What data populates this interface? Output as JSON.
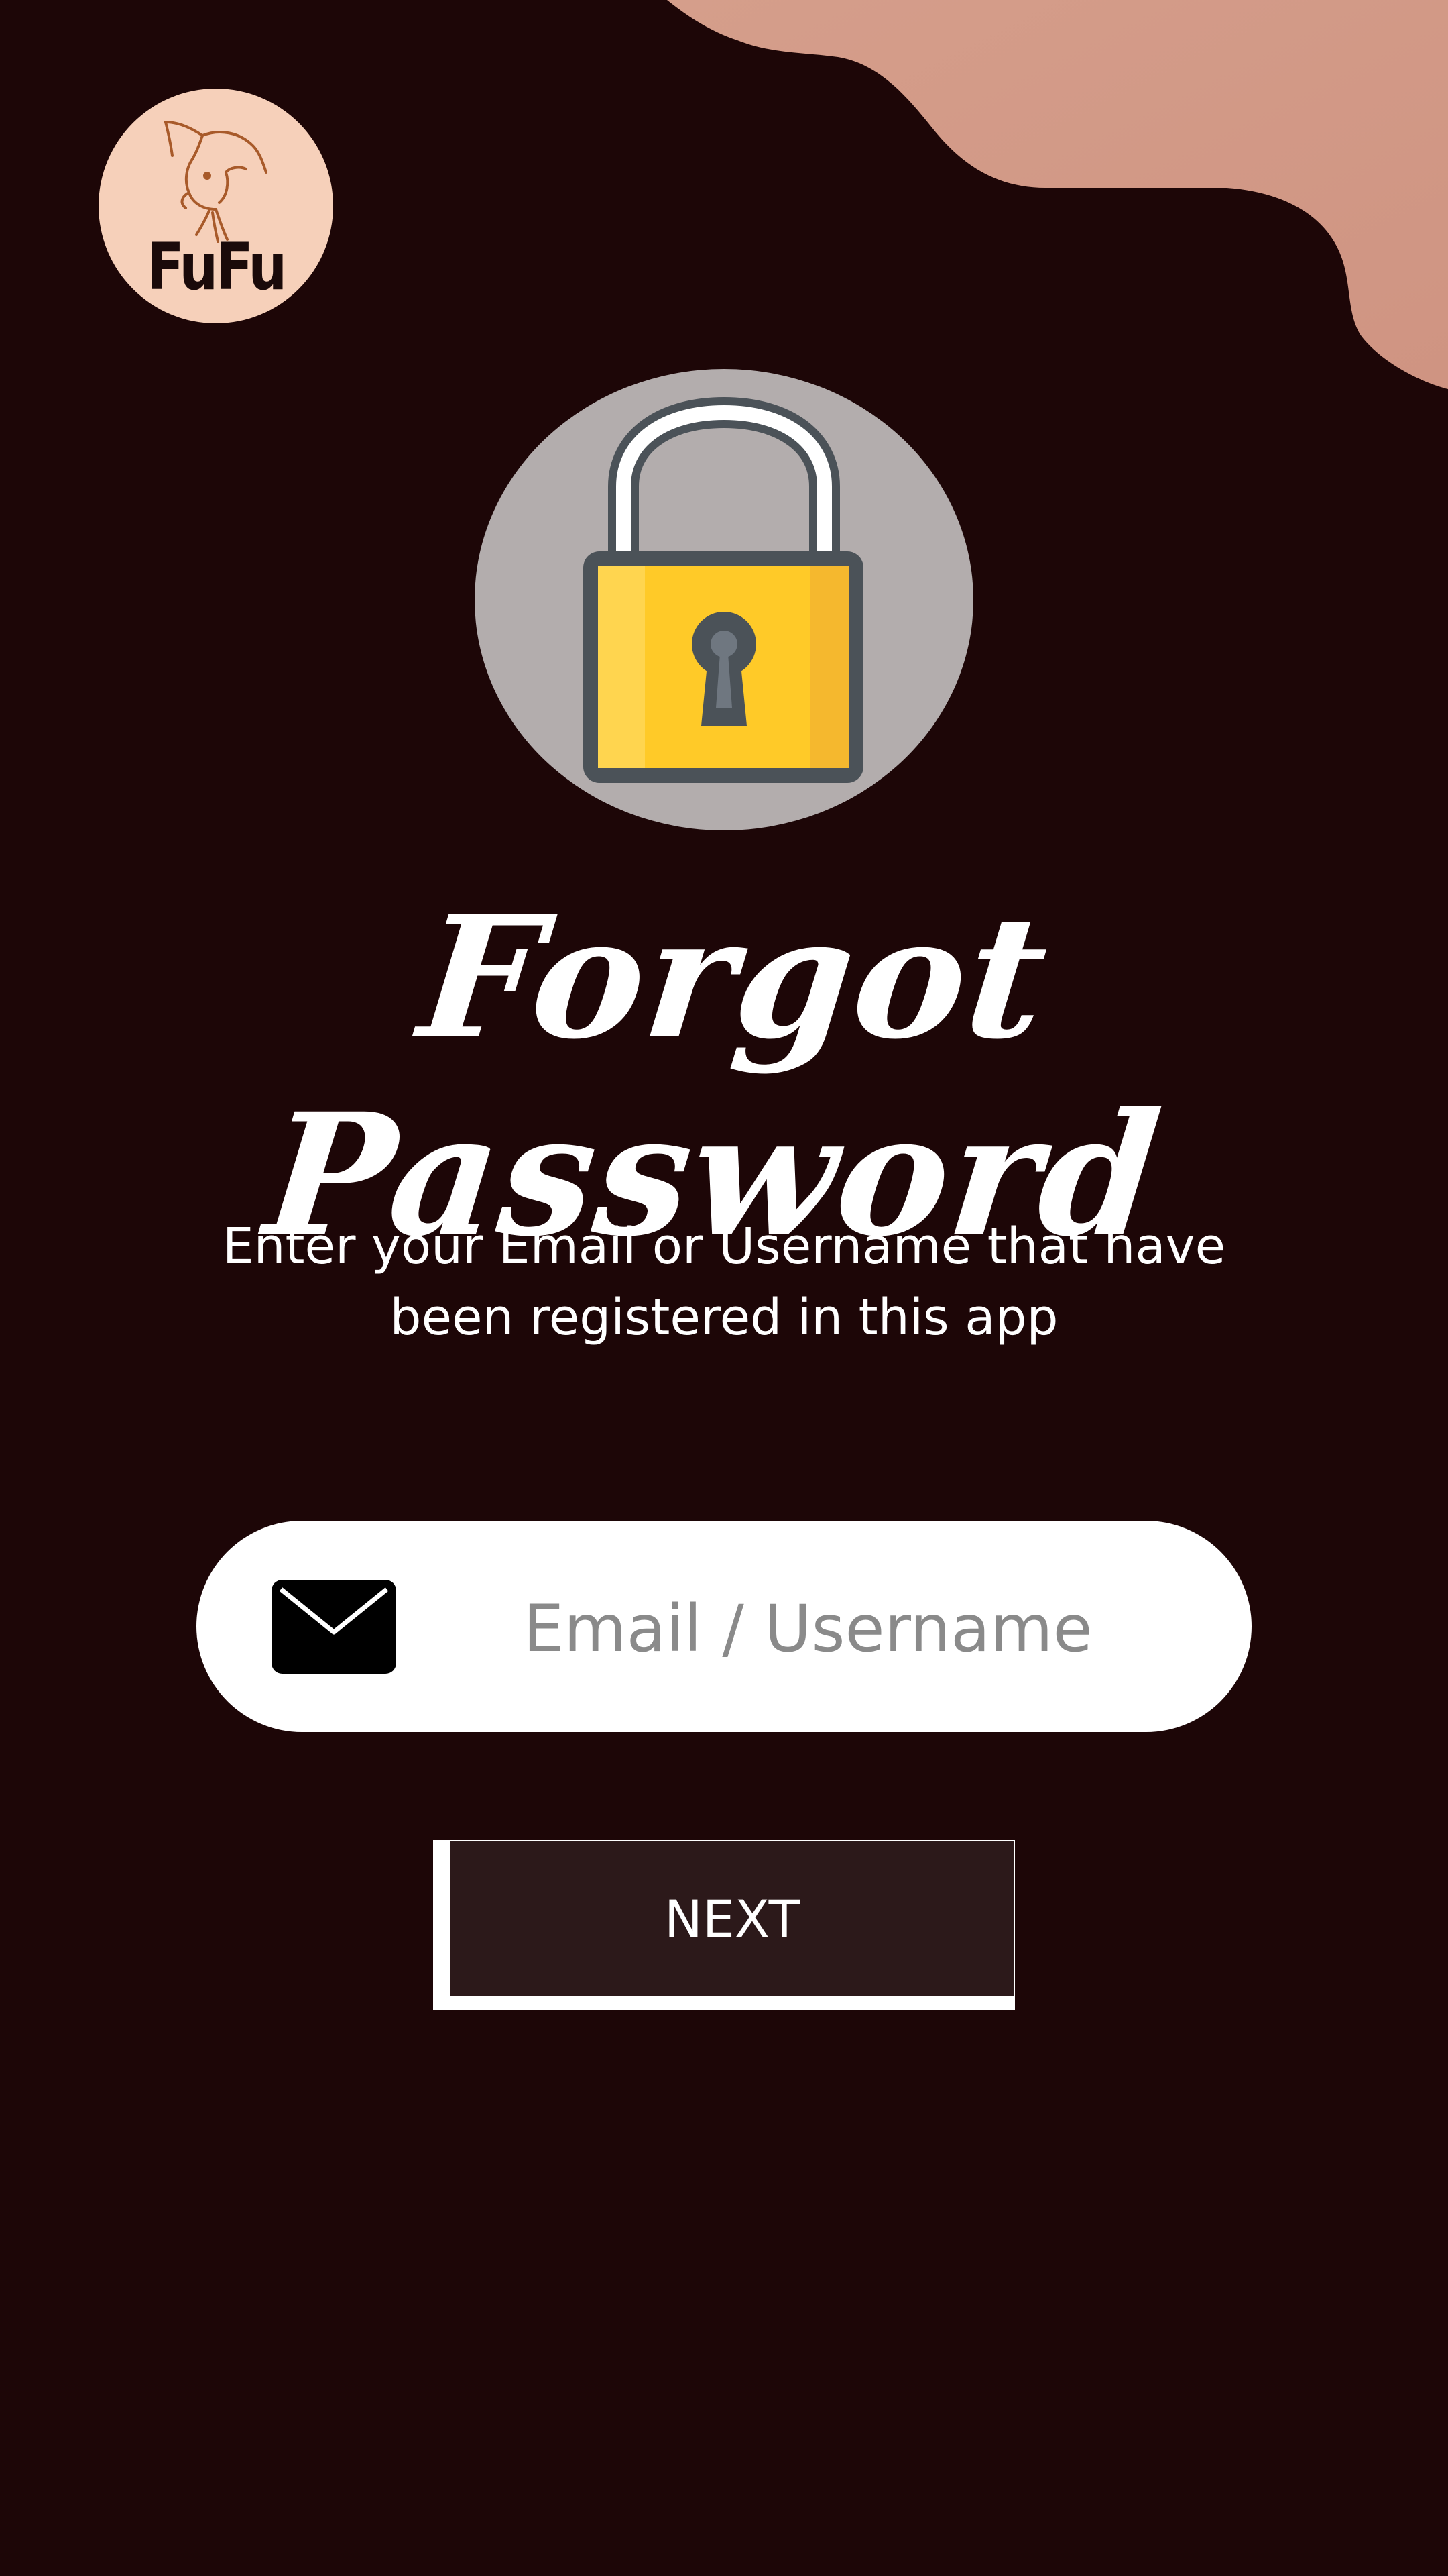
{
  "app": {
    "logo_text": "FuFu"
  },
  "header": {
    "title": "Forgot Password",
    "subtitle": "Enter your Email or Username that have been registered in this app"
  },
  "form": {
    "email_placeholder": "Email / Username",
    "email_value": "",
    "next_label": "NEXT"
  },
  "icons": {
    "logo": "cat-logo-icon",
    "hero": "padlock-icon",
    "input": "envelope-icon"
  },
  "colors": {
    "background": "#1d0607",
    "accent_blob": "#d49a88",
    "logo_bg": "#f6d0ba",
    "lock_circle": "#b3adad",
    "lock_body": "#ffcc33",
    "button_bg": "#2c191a"
  }
}
